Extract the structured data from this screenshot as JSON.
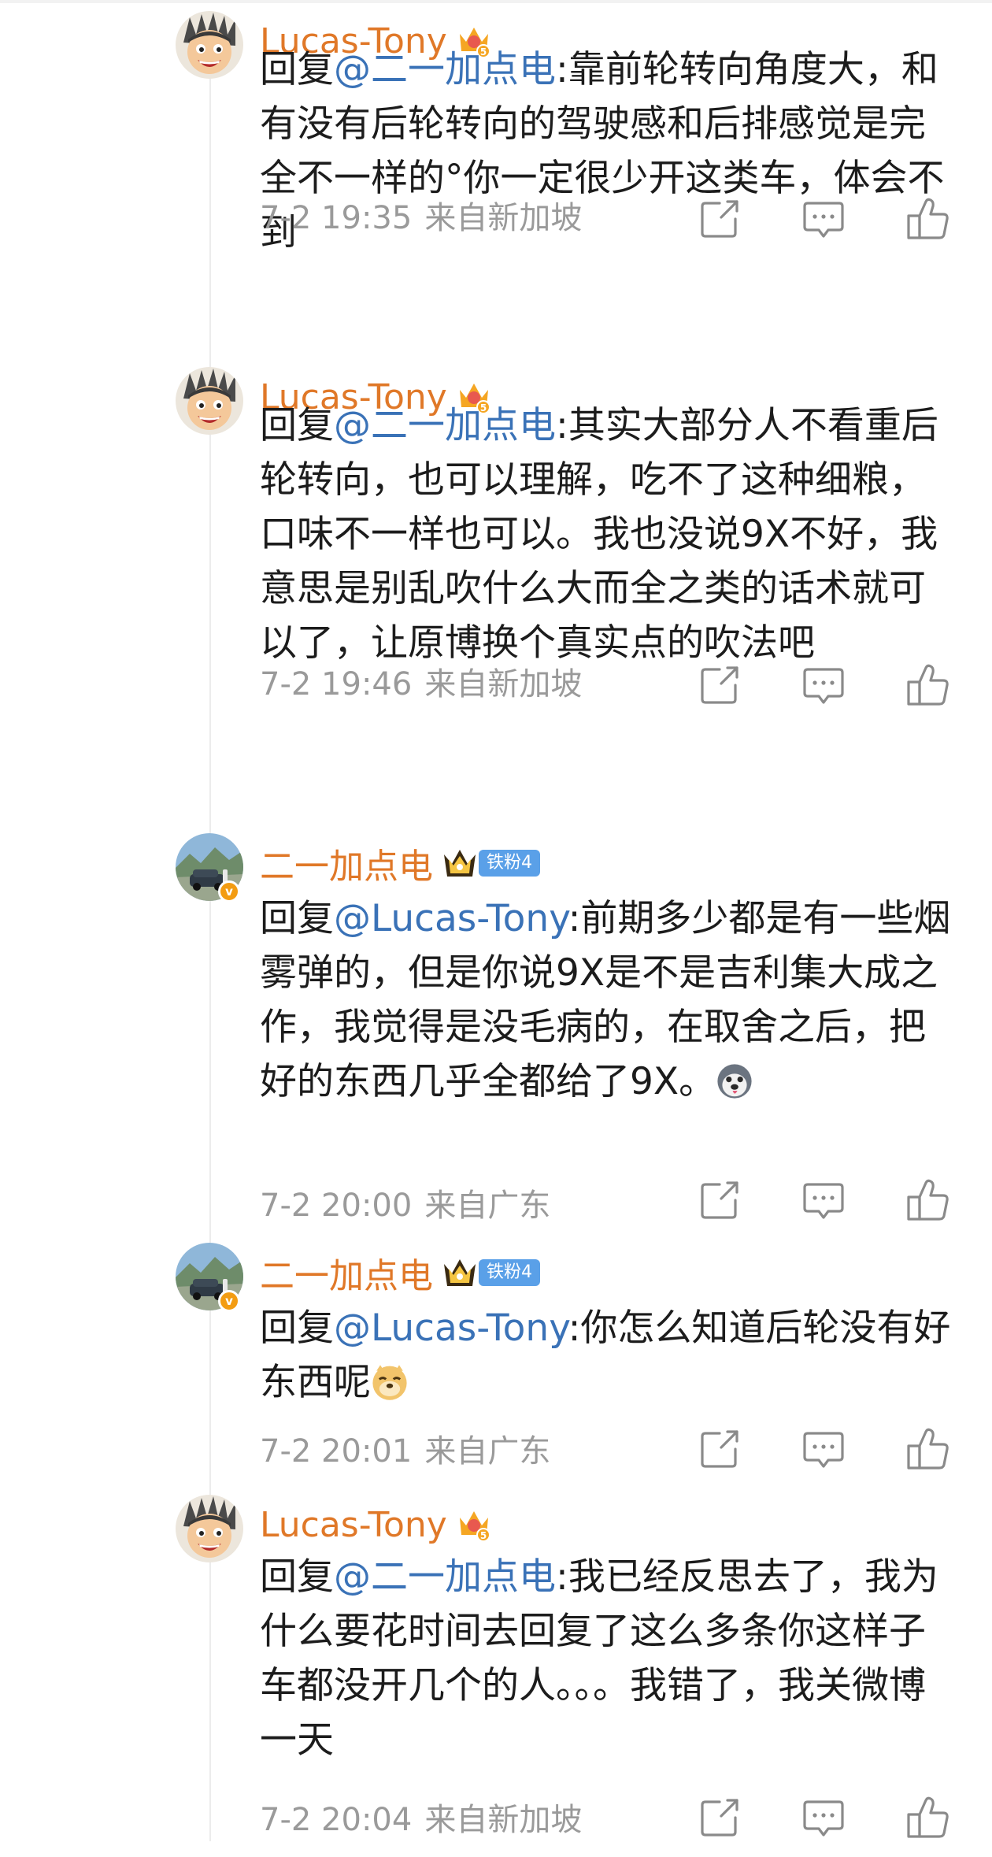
{
  "users": {
    "lucas": {
      "name": "Lucas-Tony",
      "level": "5"
    },
    "eryi": {
      "name": "二一加点电",
      "fan_badge": "铁粉4"
    }
  },
  "comments": [
    {
      "user": "Lucas-Tony",
      "prefix": "回复",
      "mention": "@二一加点电",
      "body": ":靠前轮转向角度大，和有没有后轮转向的驾驶感和后排感觉是完全不一样的°你一定很少开这类车，体会不到",
      "time": "7-2 19:35",
      "source": "来自新加坡"
    },
    {
      "user": "Lucas-Tony",
      "prefix": "回复",
      "mention": "@二一加点电",
      "body": ":其实大部分人不看重后轮转向，也可以理解，吃不了这种细粮，口味不一样也可以。我也没说9X不好，我意思是别乱吹什么大而全之类的话术就可以了，让原博换个真实点的吹法吧",
      "time": "7-2 19:46",
      "source": "来自新加坡"
    },
    {
      "user": "二一加点电",
      "prefix": "回复",
      "mention": "@Lucas-Tony",
      "body": ":前期多少都是有一些烟雾弹的，但是你说9X是不是吉利集大成之作，我觉得是没毛病的，在取舍之后，把好的东西几乎全都给了9X。",
      "emoji": "husky-emoji",
      "time": "7-2 20:00",
      "source": "来自广东"
    },
    {
      "user": "二一加点电",
      "prefix": "回复",
      "mention": "@Lucas-Tony",
      "body": ":你怎么知道后轮没有好东西呢",
      "emoji": "doge-emoji",
      "time": "7-2 20:01",
      "source": "来自广东"
    },
    {
      "user": "Lucas-Tony",
      "prefix": "回复",
      "mention": "@二一加点电",
      "body": ":我已经反思去了，我为什么要花时间去回复了这么多条你这样子车都没开几个的人。。。我错了，我关微博一天",
      "time": "7-2 20:04",
      "source": "来自新加坡"
    }
  ],
  "icons": [
    "share-icon",
    "comment-icon",
    "like-icon",
    "crown-icon",
    "verified-badge-icon"
  ],
  "colors": {
    "username": "#e07828",
    "mention": "#3a72b7",
    "meta": "#9a9a9a",
    "fan_badge": "#5aa0e8"
  }
}
